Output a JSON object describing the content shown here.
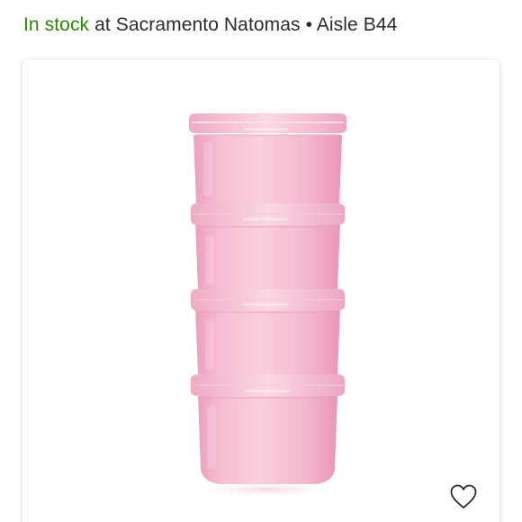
{
  "availability": {
    "status": "In stock",
    "location_text": " at Sacramento Natomas • Aisle B44"
  },
  "product": {
    "image_icon": "pink-stacked-storage-containers",
    "container_count": 4,
    "accent_color": "#f2b8cc"
  },
  "favorite": {
    "icon": "heart-outline-icon",
    "state": "not-favorited"
  },
  "colors": {
    "in_stock": "#2a8703",
    "text": "#2b2b2b"
  }
}
